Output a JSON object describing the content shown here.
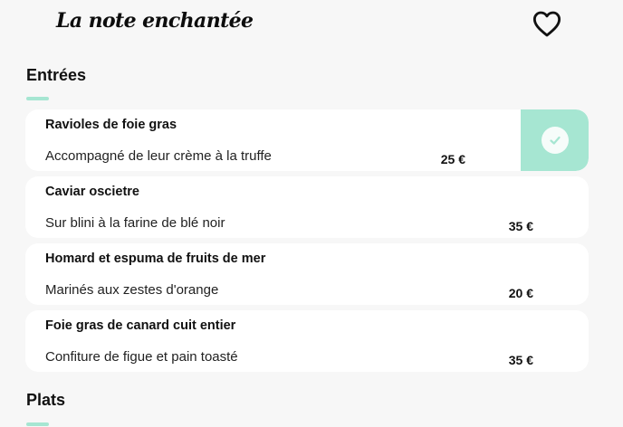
{
  "header": {
    "restaurant_name": "La note enchantée",
    "favorite_icon": "heart-outline-icon"
  },
  "colors": {
    "accent": "#a6e6d2",
    "background": "#f7f7f7",
    "card": "#ffffff"
  },
  "sections": [
    {
      "title": "Entrées",
      "items": [
        {
          "name": "Ravioles de foie gras",
          "description": "Accompagné de leur crème à la truffe",
          "price": "25 €",
          "selected": true
        },
        {
          "name": "Caviar oscietre",
          "description": "Sur blini à la farine de blé noir",
          "price": "35 €",
          "selected": false
        },
        {
          "name": "Homard et espuma de fruits de mer",
          "description": "Marinés aux zestes d'orange",
          "price": "20 €",
          "selected": false
        },
        {
          "name": "Foie gras de canard cuit entier",
          "description": "Confiture de figue et pain toasté",
          "price": "35 €",
          "selected": false
        }
      ]
    },
    {
      "title": "Plats",
      "items": []
    }
  ]
}
